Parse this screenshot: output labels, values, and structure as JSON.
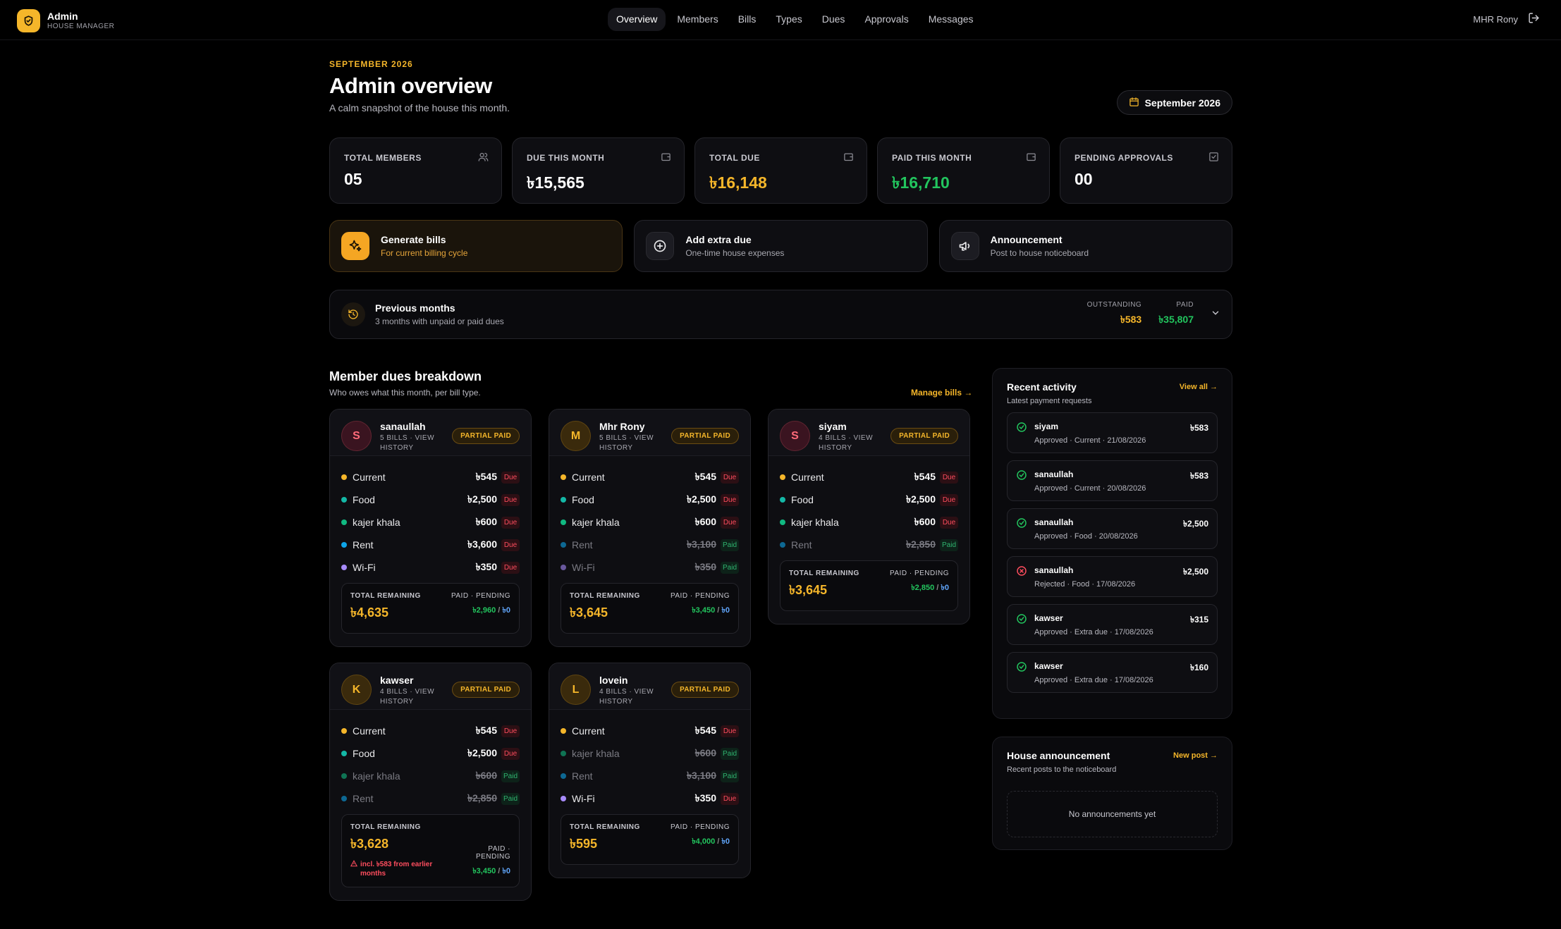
{
  "brand": {
    "title": "Admin",
    "subtitle": "HOUSE MANAGER"
  },
  "nav": [
    "Overview",
    "Members",
    "Bills",
    "Types",
    "Dues",
    "Approvals",
    "Messages"
  ],
  "user": {
    "name": "MHR Rony"
  },
  "header": {
    "eyebrow": "SEPTEMBER 2026",
    "title": "Admin overview",
    "subtitle": "A calm snapshot of the house this month.",
    "month_picker": "September 2026"
  },
  "stats": [
    {
      "label": "TOTAL MEMBERS",
      "value": "05",
      "color": "#ffffff"
    },
    {
      "label": "DUE THIS MONTH",
      "value": "৳15,565",
      "color": "#ffffff"
    },
    {
      "label": "TOTAL DUE",
      "value": "৳16,148",
      "color": "#f5b62a"
    },
    {
      "label": "PAID THIS MONTH",
      "value": "৳16,710",
      "color": "#22c55e"
    },
    {
      "label": "PENDING APPROVALS",
      "value": "00",
      "color": "#ffffff"
    }
  ],
  "actions": [
    {
      "title": "Generate bills",
      "subtitle": "For current billing cycle"
    },
    {
      "title": "Add extra due",
      "subtitle": "One-time house expenses"
    },
    {
      "title": "Announcement",
      "subtitle": "Post to house noticeboard"
    }
  ],
  "previous": {
    "title": "Previous months",
    "subtitle": "3 months with unpaid or paid dues",
    "outstanding_label": "OUTSTANDING",
    "outstanding": "৳583",
    "paid_label": "PAID",
    "paid": "৳35,807"
  },
  "breakdown": {
    "title": "Member dues breakdown",
    "subtitle": "Who owes what this month, per bill type.",
    "manage": "Manage bills →"
  },
  "members": [
    {
      "initial": "S",
      "name": "sanaullah",
      "meta": "5 BILLS · VIEW HISTORY",
      "status": "PARTIAL PAID",
      "items": [
        {
          "label": "Current",
          "amount": "৳545",
          "tag": "Due",
          "color": "#f5b62a"
        },
        {
          "label": "Food",
          "amount": "৳2,500",
          "tag": "Due",
          "color": "#14b8a6"
        },
        {
          "label": "kajer khala",
          "amount": "৳600",
          "tag": "Due",
          "color": "#10b981"
        },
        {
          "label": "Rent",
          "amount": "৳3,600",
          "tag": "Due",
          "color": "#0ea5e9"
        },
        {
          "label": "Wi-Fi",
          "amount": "৳350",
          "tag": "Due",
          "color": "#a78bfa"
        }
      ],
      "remaining_label": "TOTAL REMAINING",
      "remaining": "৳4,635",
      "pp_label": "PAID · PENDING",
      "paid": "৳2,960",
      "pending": "৳0",
      "note": ""
    },
    {
      "initial": "M",
      "name": "Mhr Rony",
      "meta": "5 BILLS · VIEW HISTORY",
      "status": "PARTIAL PAID",
      "items": [
        {
          "label": "Current",
          "amount": "৳545",
          "tag": "Due",
          "color": "#f5b62a"
        },
        {
          "label": "Food",
          "amount": "৳2,500",
          "tag": "Due",
          "color": "#14b8a6"
        },
        {
          "label": "kajer khala",
          "amount": "৳600",
          "tag": "Due",
          "color": "#10b981"
        },
        {
          "label": "Rent",
          "amount": "৳3,100",
          "tag": "Paid",
          "color": "#0ea5e9"
        },
        {
          "label": "Wi-Fi",
          "amount": "৳350",
          "tag": "Paid",
          "color": "#a78bfa"
        }
      ],
      "remaining_label": "TOTAL REMAINING",
      "remaining": "৳3,645",
      "pp_label": "PAID · PENDING",
      "paid": "৳3,450",
      "pending": "৳0",
      "note": ""
    },
    {
      "initial": "S",
      "name": "siyam",
      "meta": "4 BILLS · VIEW HISTORY",
      "status": "PARTIAL PAID",
      "items": [
        {
          "label": "Current",
          "amount": "৳545",
          "tag": "Due",
          "color": "#f5b62a"
        },
        {
          "label": "Food",
          "amount": "৳2,500",
          "tag": "Due",
          "color": "#14b8a6"
        },
        {
          "label": "kajer khala",
          "amount": "৳600",
          "tag": "Due",
          "color": "#10b981"
        },
        {
          "label": "Rent",
          "amount": "৳2,850",
          "tag": "Paid",
          "color": "#0ea5e9"
        }
      ],
      "remaining_label": "TOTAL REMAINING",
      "remaining": "৳3,645",
      "pp_label": "PAID · PENDING",
      "paid": "৳2,850",
      "pending": "৳0",
      "note": ""
    },
    {
      "initial": "K",
      "name": "kawser",
      "meta": "4 BILLS · VIEW HISTORY",
      "status": "PARTIAL PAID",
      "items": [
        {
          "label": "Current",
          "amount": "৳545",
          "tag": "Due",
          "color": "#f5b62a"
        },
        {
          "label": "Food",
          "amount": "৳2,500",
          "tag": "Due",
          "color": "#14b8a6"
        },
        {
          "label": "kajer khala",
          "amount": "৳600",
          "tag": "Paid",
          "color": "#10b981"
        },
        {
          "label": "Rent",
          "amount": "৳2,850",
          "tag": "Paid",
          "color": "#0ea5e9"
        }
      ],
      "remaining_label": "TOTAL REMAINING",
      "remaining": "৳3,628",
      "pp_label": "PAID · PENDING",
      "paid": "৳3,450",
      "pending": "৳0",
      "note": "incl. ৳583 from earlier months"
    },
    {
      "initial": "L",
      "name": "lovein",
      "meta": "4 BILLS · VIEW HISTORY",
      "status": "PARTIAL PAID",
      "items": [
        {
          "label": "Current",
          "amount": "৳545",
          "tag": "Due",
          "color": "#f5b62a"
        },
        {
          "label": "kajer khala",
          "amount": "৳600",
          "tag": "Paid",
          "color": "#10b981"
        },
        {
          "label": "Rent",
          "amount": "৳3,100",
          "tag": "Paid",
          "color": "#0ea5e9"
        },
        {
          "label": "Wi-Fi",
          "amount": "৳350",
          "tag": "Due",
          "color": "#a78bfa"
        }
      ],
      "remaining_label": "TOTAL REMAINING",
      "remaining": "৳595",
      "pp_label": "PAID · PENDING",
      "paid": "৳4,000",
      "pending": "৳0",
      "note": ""
    }
  ],
  "activity": {
    "title": "Recent activity",
    "subtitle": "Latest payment requests",
    "link": "View all →",
    "items": [
      {
        "name": "siyam",
        "detail": "Approved · Current · 21/08/2026",
        "amount": "৳583",
        "status": "approved"
      },
      {
        "name": "sanaullah",
        "detail": "Approved · Current · 20/08/2026",
        "amount": "৳583",
        "status": "approved"
      },
      {
        "name": "sanaullah",
        "detail": "Approved · Food · 20/08/2026",
        "amount": "৳2,500",
        "status": "approved"
      },
      {
        "name": "sanaullah",
        "detail": "Rejected · Food · 17/08/2026",
        "amount": "৳2,500",
        "status": "rejected"
      },
      {
        "name": "kawser",
        "detail": "Approved · Extra due · 17/08/2026",
        "amount": "৳315",
        "status": "approved"
      },
      {
        "name": "kawser",
        "detail": "Approved · Extra due · 17/08/2026",
        "amount": "৳160",
        "status": "approved"
      }
    ]
  },
  "announcement": {
    "title": "House announcement",
    "subtitle": "Recent posts to the noticeboard",
    "link": "New post →",
    "empty": "No announcements yet"
  }
}
